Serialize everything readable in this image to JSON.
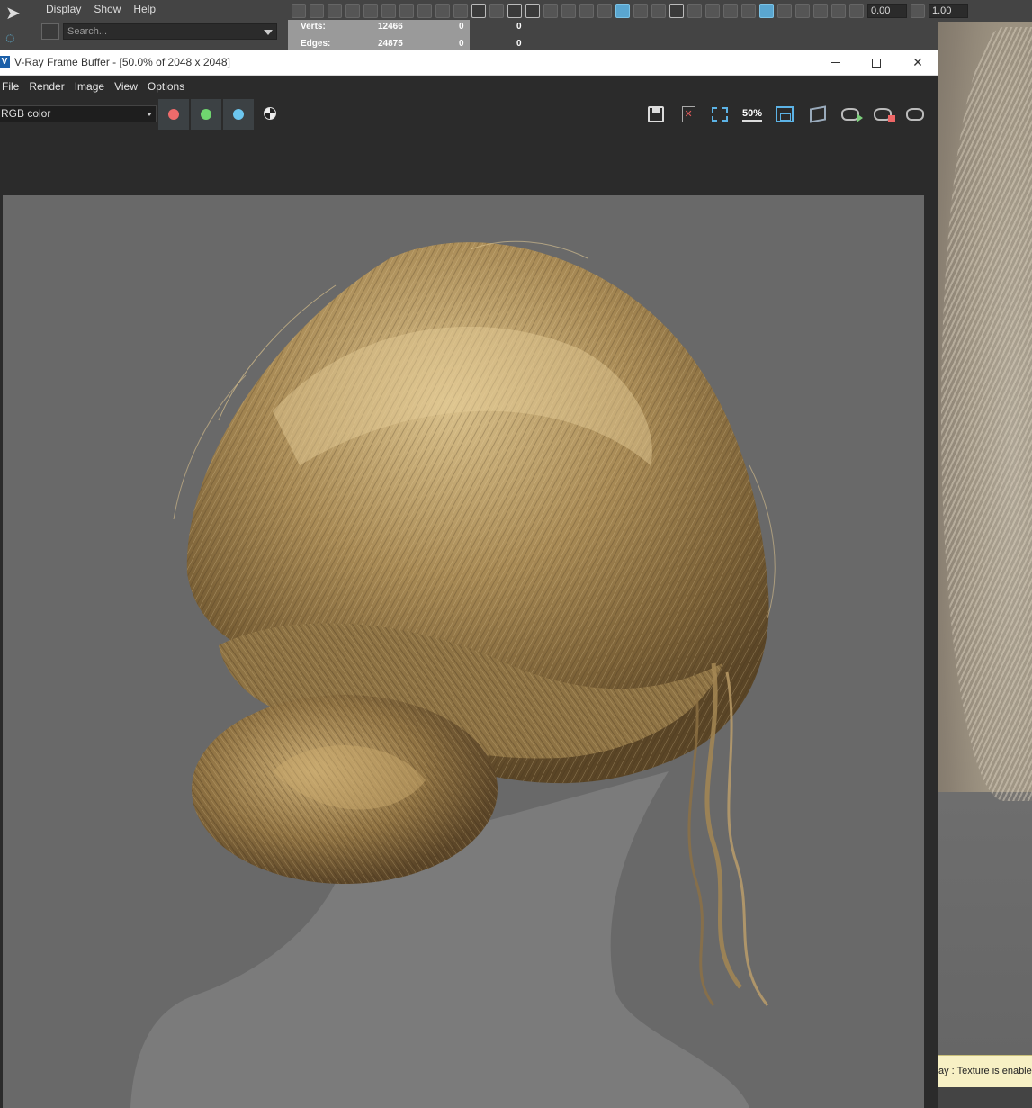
{
  "maya": {
    "menu": [
      "Display",
      "Show",
      "Help"
    ],
    "search_placeholder": "Search...",
    "stats": {
      "rows": [
        {
          "label": "Verts:",
          "v1": "12466",
          "v2": "0",
          "v3": "0"
        },
        {
          "label": "Edges:",
          "v1": "24875",
          "v2": "0",
          "v3": "0"
        }
      ]
    },
    "toolbar_fields": [
      "0.00",
      "1.00"
    ],
    "help_line": "ay : Texture is enabled"
  },
  "vfb": {
    "title": "V-Ray Frame Buffer - [50.0% of 2048 x 2048]",
    "logo": "V",
    "menu": [
      "File",
      "Render",
      "Image",
      "View",
      "Options"
    ],
    "channel": "RGB color",
    "channel_dots": [
      {
        "name": "red-channel",
        "color": "#ee6b6b"
      },
      {
        "name": "green-channel",
        "color": "#6fd56f"
      },
      {
        "name": "blue-channel",
        "color": "#6cc6ef"
      }
    ],
    "zoom_label": "50",
    "zoom_suffix": "%",
    "toolbar_icons": [
      "save-icon",
      "clear-image-icon",
      "region-render-icon",
      "zoom-icon",
      "track-mouse-icon",
      "render-settings-icon",
      "interactive-render-icon",
      "stop-render-icon",
      "render-last-icon"
    ]
  },
  "colors": {
    "render_bg": "#696969",
    "hair_base": "#8c7446",
    "hair_light": "#d7bd86",
    "hair_dark": "#5c4628",
    "mannequin": "#7b7b7b"
  }
}
